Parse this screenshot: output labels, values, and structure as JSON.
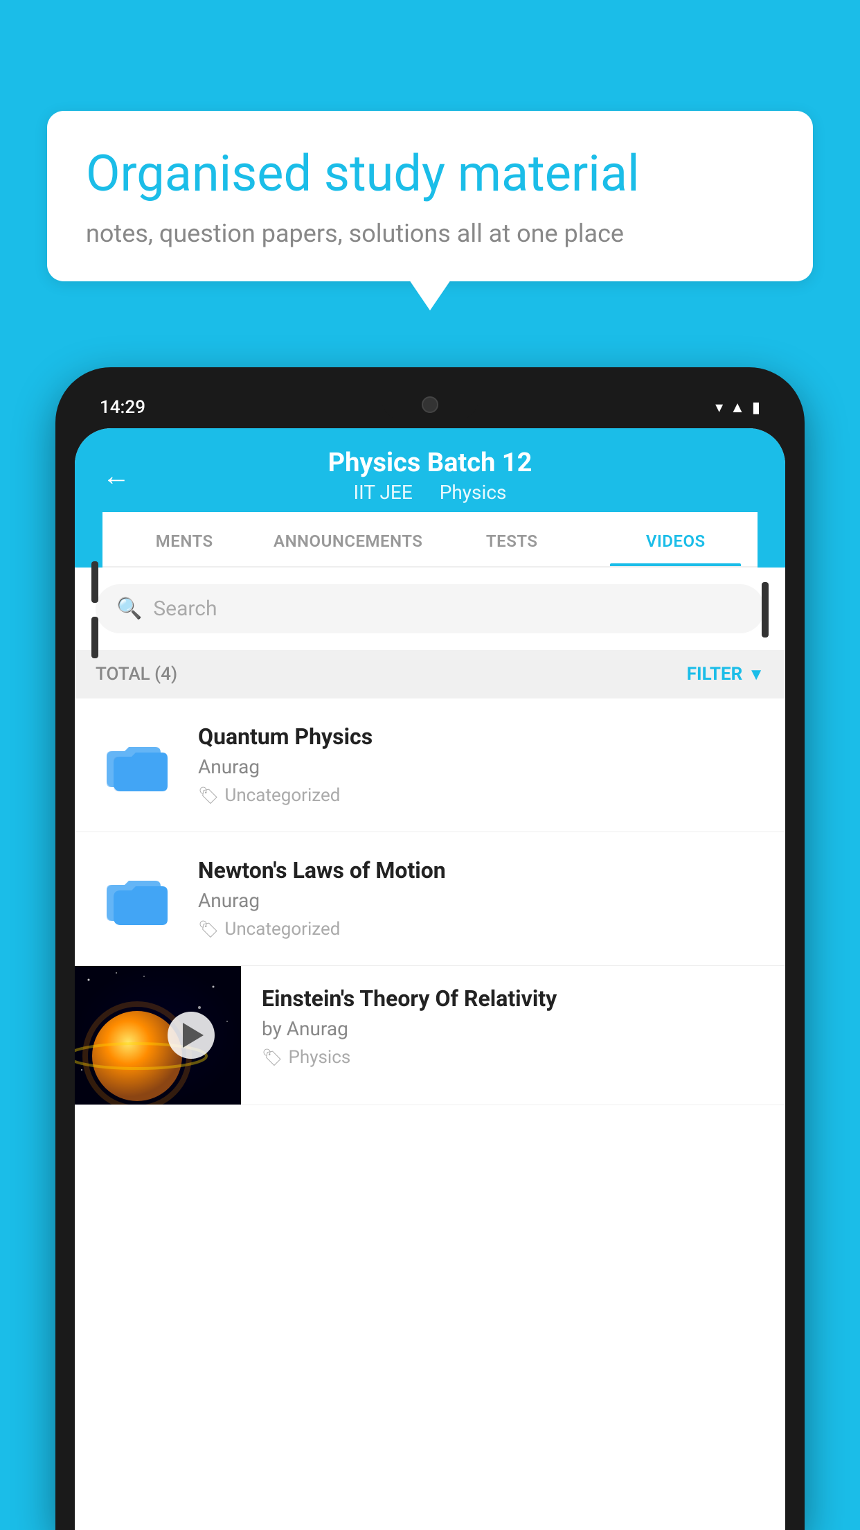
{
  "background": {
    "color": "#1BBDE8"
  },
  "speech_bubble": {
    "headline": "Organised study material",
    "subtitle": "notes, question papers, solutions all at one place"
  },
  "phone": {
    "status_bar": {
      "time": "14:29"
    },
    "header": {
      "back_label": "←",
      "title": "Physics Batch 12",
      "subtitle1": "IIT JEE",
      "subtitle2": "Physics"
    },
    "tabs": [
      {
        "label": "MENTS",
        "active": false
      },
      {
        "label": "ANNOUNCEMENTS",
        "active": false
      },
      {
        "label": "TESTS",
        "active": false
      },
      {
        "label": "VIDEOS",
        "active": true
      }
    ],
    "search": {
      "placeholder": "Search"
    },
    "filter": {
      "total_label": "TOTAL (4)",
      "filter_label": "FILTER"
    },
    "videos": [
      {
        "id": 1,
        "title": "Quantum Physics",
        "author": "Anurag",
        "tag": "Uncategorized",
        "has_thumbnail": false
      },
      {
        "id": 2,
        "title": "Newton's Laws of Motion",
        "author": "Anurag",
        "tag": "Uncategorized",
        "has_thumbnail": false
      },
      {
        "id": 3,
        "title": "Einstein's Theory Of Relativity",
        "author": "by Anurag",
        "tag": "Physics",
        "has_thumbnail": true
      }
    ]
  }
}
